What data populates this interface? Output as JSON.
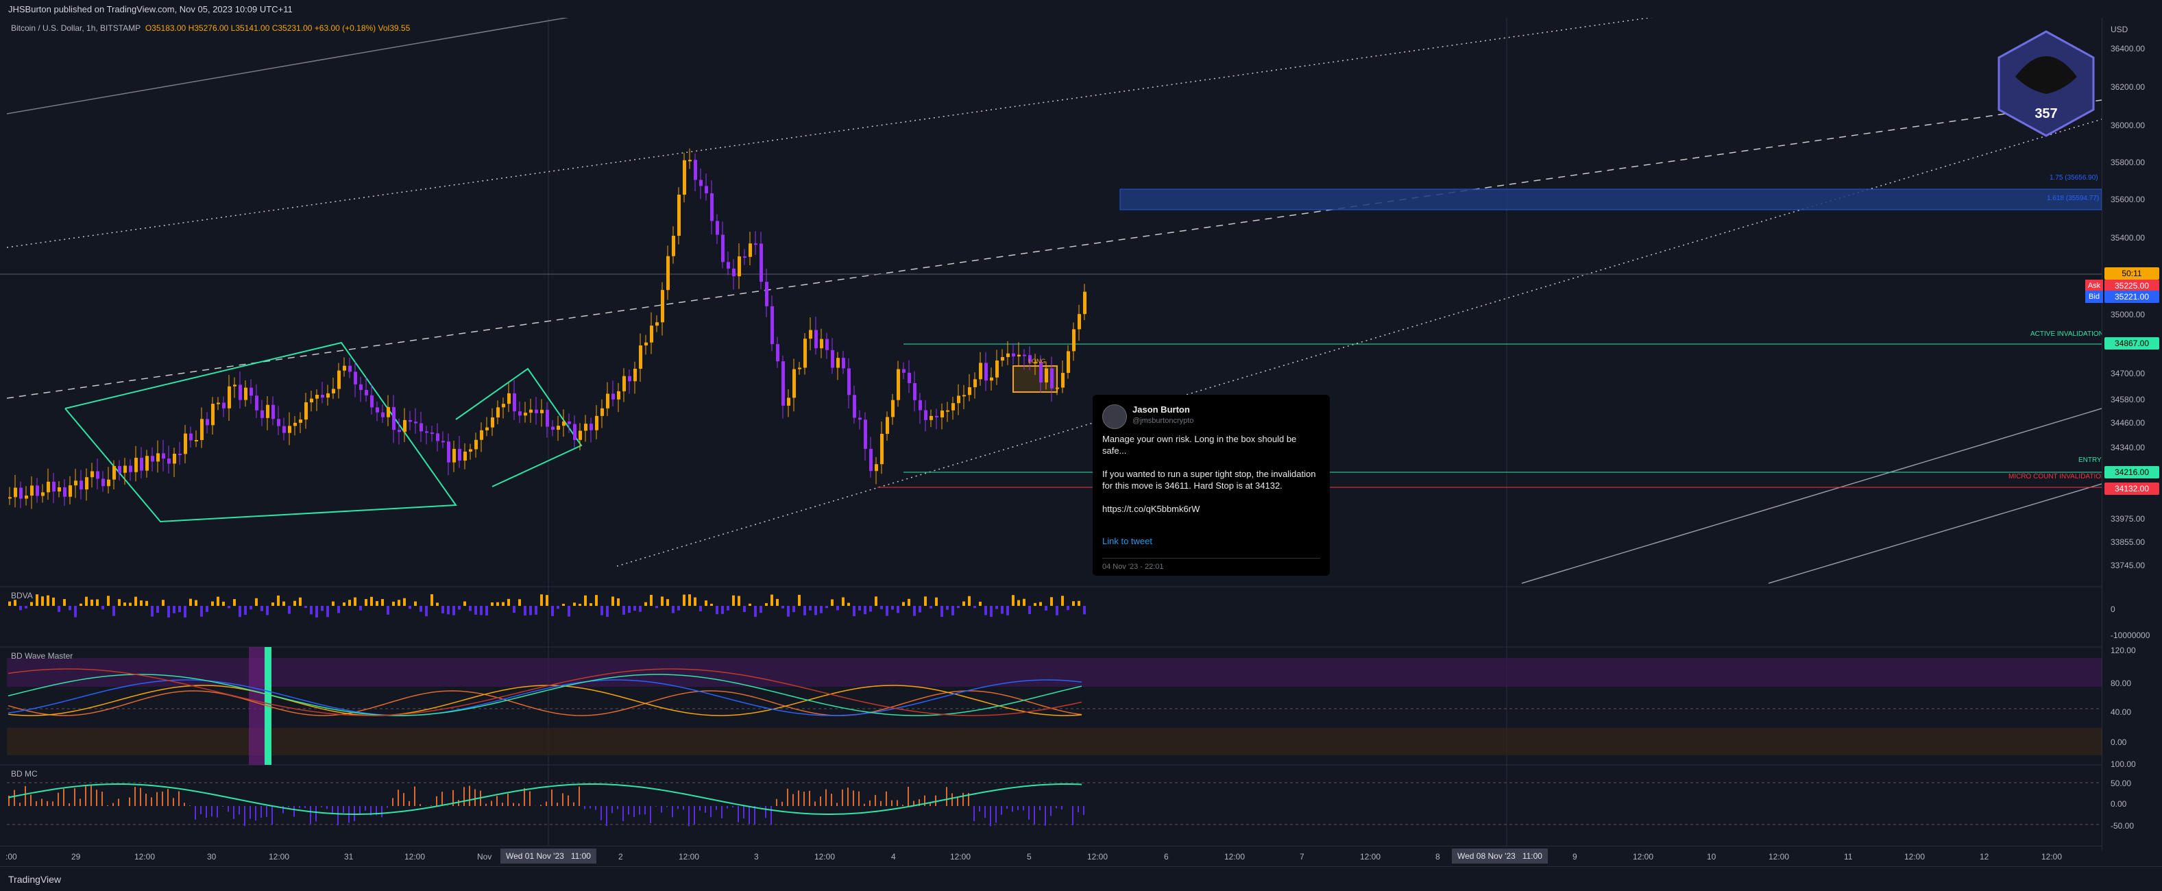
{
  "header": {
    "publish_line": "JHSBurton published on TradingView.com, Nov 05, 2023 10:09 UTC+11",
    "symbol": "Bitcoin / U.S. Dollar, 1h, BITSTAMP",
    "ohlc": {
      "open": "O35183.00",
      "high": "H35276.00",
      "low": "L35141.00",
      "close": "C35231.00",
      "change": "+63.00 (+0.18%)",
      "vol": "Vol39.55"
    }
  },
  "price_axis": {
    "currency": "USD",
    "labels": [
      "36400.00",
      "36200.00",
      "36000.00",
      "35800.00",
      "35600.00",
      "35400.00",
      "35000.00",
      "34700.00",
      "34580.00",
      "34460.00",
      "34340.00",
      "33975.00",
      "33855.00",
      "33745.00"
    ],
    "tags": {
      "current": "50:11",
      "ask_label": "Ask",
      "ask": "35225.00",
      "bid_label": "Bid",
      "bid": "35221.00",
      "invalidation": "34867.00",
      "entry": "34216.00",
      "stop": "34132.00"
    },
    "bdva_labels": [
      "0",
      "-10000000"
    ],
    "wave_labels": [
      "120.00",
      "80.00",
      "40.00",
      "0.00"
    ],
    "mc_labels": [
      "100.00",
      "50.00",
      "0.00",
      "-50.00"
    ]
  },
  "zones": {
    "fib_1": "1.75 (35656.90)",
    "fib_2": "1.618 (35594.77)",
    "active_invalidation": "ACTIVE INVALIDATION",
    "entry": "ENTRY",
    "micro": "MICRO COUNT INVALIDATION",
    "long_box": "LONG"
  },
  "panes": {
    "bdva": "BDVA",
    "wave": "BD Wave Master",
    "mc": "BD MC"
  },
  "time_axis": {
    "labels": [
      ":00",
      "29",
      "12:00",
      "30",
      "12:00",
      "31",
      "12:00",
      "Nov",
      "2",
      "12:00",
      "3",
      "12:00",
      "4",
      "12:00",
      "5",
      "12:00",
      "6",
      "12:00",
      "7",
      "12:00",
      "8",
      "9",
      "12:00",
      "10",
      "12:00",
      "11",
      "12:00",
      "12",
      "12:00"
    ],
    "highlight_1": "Wed 01 Nov '23",
    "highlight_1_time": "11:00",
    "highlight_2": "Wed 08 Nov '23",
    "highlight_2_time": "11:00"
  },
  "tweet": {
    "name": "Jason Burton",
    "handle": "@jmsburtoncrypto",
    "body": "Manage your own risk. Long in the box should be safe...\n\nIf you wanted to run a super tight stop, the invalidation for this move is 34611. Hard Stop is at 34132.\n\nhttps://t.co/qK5bbmk6rW",
    "link": "Link to tweet",
    "date": "04 Nov '23 - 22:01"
  },
  "logo_text": "357",
  "footer": {
    "brand": "TradingView"
  },
  "colors": {
    "bg": "#131722",
    "bull": "#f7a600",
    "bear": "#9b30ff",
    "teal": "#2ee6a6",
    "red": "#f23645",
    "blue": "#2962ff"
  }
}
